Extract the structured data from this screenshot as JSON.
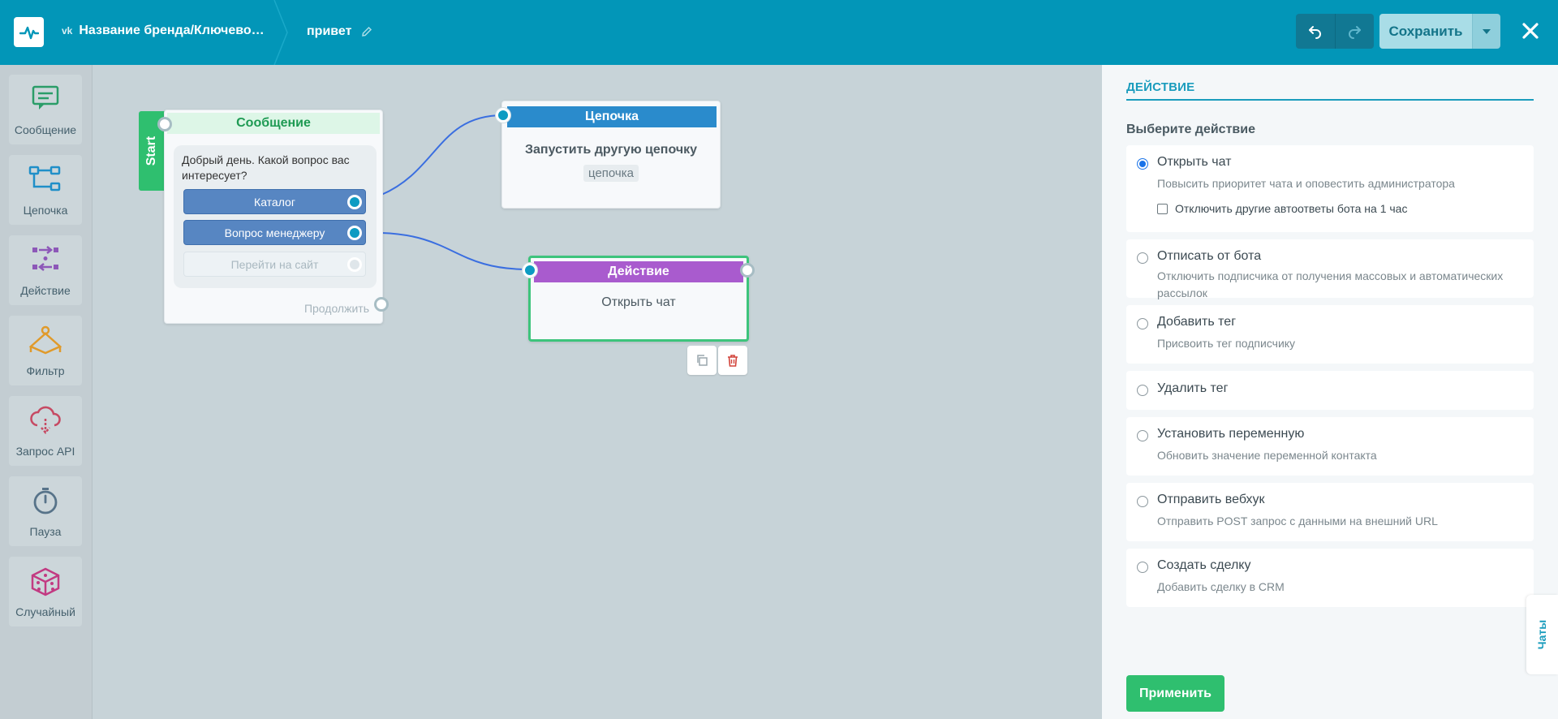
{
  "header": {
    "brand_name": "Название бренда/Ключево…",
    "flow_name": "привет",
    "save_label": "Сохранить"
  },
  "toolbar": {
    "items": [
      {
        "label": "Сообщение",
        "icon": "message-icon",
        "color": "#2a9d68"
      },
      {
        "label": "Цепочка",
        "icon": "chain-icon",
        "color": "#1f8fc8"
      },
      {
        "label": "Действие",
        "icon": "action-icon",
        "color": "#8d58b8"
      },
      {
        "label": "Фильтр",
        "icon": "filter-icon",
        "color": "#e09a2a"
      },
      {
        "label": "Запрос API",
        "icon": "api-request-icon",
        "color": "#c64a63"
      },
      {
        "label": "Пауза",
        "icon": "pause-icon",
        "color": "#577389"
      },
      {
        "label": "Случайный",
        "icon": "dice-icon",
        "color": "#c23a82"
      }
    ]
  },
  "canvas": {
    "start_label": "Start",
    "message_node": {
      "title": "Сообщение",
      "text": "Добрый день. Какой вопрос вас интересует?",
      "buttons": [
        "Каталог",
        "Вопрос менеджеру",
        "Перейти на сайт"
      ],
      "continue_label": "Продолжить"
    },
    "chain_node": {
      "title": "Цепочка",
      "text": "Запустить другую цепочку",
      "tag": "цепочка"
    },
    "action_node": {
      "title": "Действие",
      "text": "Открыть чат"
    }
  },
  "panel": {
    "title": "ДЕЙСТВИЕ",
    "subtitle": "Выберите действие",
    "options": [
      {
        "title": "Открыть чат",
        "desc": "Повысить приоритет чата и оповестить администратора",
        "selected": true,
        "checkbox_label": "Отключить другие автоответы бота на 1 час"
      },
      {
        "title": "Отписать от бота",
        "desc": "Отключить подписчика от получения массовых и автоматических рассылок"
      },
      {
        "title": "Добавить тег",
        "desc": "Присвоить тег подписчику"
      },
      {
        "title": "Удалить тег",
        "desc": ""
      },
      {
        "title": "Установить переменную",
        "desc": "Обновить значение переменной контакта"
      },
      {
        "title": "Отправить вебхук",
        "desc": "Отправить POST запрос с данными на внешний URL"
      },
      {
        "title": "Создать сделку",
        "desc": "Добавить сделку в CRM"
      }
    ],
    "apply_label": "Применить",
    "chats_tab_label": "Чаты"
  },
  "colors": {
    "header_bg": "#0296b8",
    "accent_green": "#2fbf6f",
    "chain_blue": "#2a8bcc",
    "action_purple": "#a95bce",
    "wire_blue": "#3a6ee0"
  }
}
